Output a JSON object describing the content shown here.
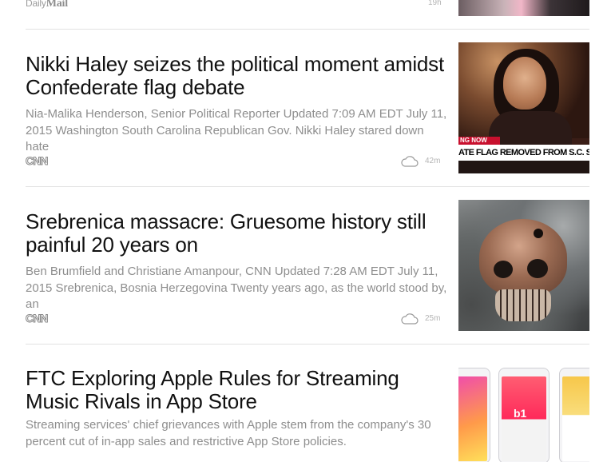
{
  "top_item": {
    "source_daily": "Daily",
    "source_mail": "Mail",
    "time": "19h"
  },
  "stories": [
    {
      "title": "Nikki Haley seizes the political moment amidst Confederate flag debate",
      "summary": "Nia-Malika Henderson, Senior Political Reporter Updated 7:09 AM EDT July 11, 2015 Washington South Carolina Republican Gov. Nikki Haley stared down hate",
      "source": "CNN",
      "time": "42m",
      "thumb": {
        "tag": "NG NOW",
        "banner": "ATE FLAG REMOVED FROM S.C. STATEHOUSE"
      }
    },
    {
      "title": "Srebrenica massacre: Gruesome history still painful 20 years on",
      "summary": "Ben Brumfield and Christiane Amanpour, CNN Updated 7:28 AM EDT July 11, 2015 Srebrenica, Bosnia Herzegovina Twenty years ago, as the world stood by, an",
      "source": "CNN",
      "time": "25m"
    },
    {
      "title": "FTC Exploring Apple Rules for Streaming Music Rivals in App Store",
      "summary": "Streaming services' chief grievances with Apple stem from the company's 30 percent cut of in-app sales and restrictive App Store policies.",
      "thumb": {
        "badge": "b1"
      }
    }
  ],
  "icons": {
    "cloud": "icloud-icon"
  }
}
